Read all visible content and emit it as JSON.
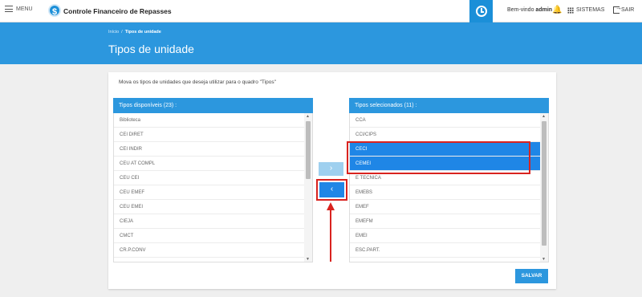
{
  "topbar": {
    "menu_label": "MENU",
    "app_title": "Controle Financeiro de Repasses",
    "logo_glyph": "$",
    "welcome_prefix": "Bem-vindo",
    "username": "admin",
    "systems_label": "SISTEMAS",
    "exit_label": "SAIR",
    "accent_color": "#1b8fd8"
  },
  "breadcrumb": {
    "home": "Início",
    "separator": "/",
    "current": "Tipos de unidade"
  },
  "page_title": "Tipos de unidade",
  "instruction": "Mova os tipos de unidades que deseja utilizar para o quadro \"Tipos\"",
  "available": {
    "header": "Tipos disponíveis (23) :",
    "items": [
      "Biblioteca",
      "CEI DIRET",
      "CEI INDIR",
      "CEU AT COMPL",
      "CEU CEI",
      "CEU EMEF",
      "CEU EMEI",
      "CIEJA",
      "CMCT",
      "CR.P.CONV"
    ]
  },
  "selected": {
    "header": "Tipos selecionados (11) :",
    "items": [
      "CCA",
      "CCI/CIPS",
      "CECI",
      "CEMEI",
      "E TECNICA",
      "EMEBS",
      "EMEF",
      "EMEFM",
      "EMEI",
      "ESC.PART."
    ],
    "highlighted": [
      "CECI",
      "CEMEI"
    ]
  },
  "buttons": {
    "move_right": "›",
    "move_left": "‹",
    "save": "SALVAR"
  },
  "colors": {
    "banner": "#2c97de",
    "selected_item": "#1f86e6",
    "annotation_red": "#d9231f"
  }
}
